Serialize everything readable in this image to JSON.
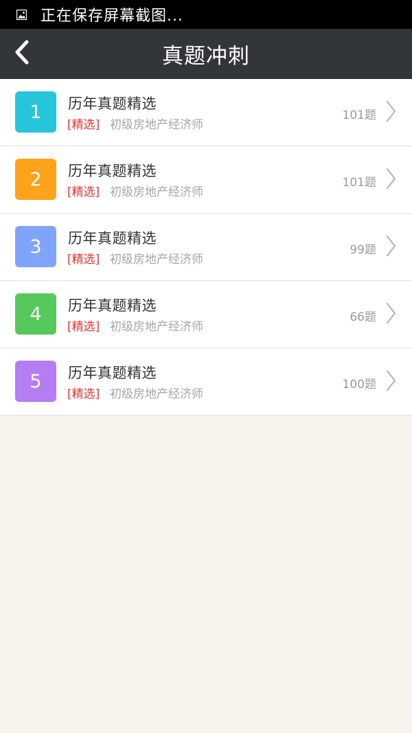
{
  "status_bar": {
    "icon": "image-icon",
    "text": "正在保存屏幕截图..."
  },
  "app_bar": {
    "back_icon": "chevron-left-icon",
    "title": "真题冲刺"
  },
  "items": [
    {
      "number": "1",
      "title": "历年真题精选",
      "tag": "[精选]",
      "subtitle": "初级房地产经济师",
      "count": "101题",
      "color": "#26c6da"
    },
    {
      "number": "2",
      "title": "历年真题精选",
      "tag": "[精选]",
      "subtitle": "初级房地产经济师",
      "count": "101题",
      "color": "#ffa31a"
    },
    {
      "number": "3",
      "title": "历年真题精选",
      "tag": "[精选]",
      "subtitle": "初级房地产经济师",
      "count": "99题",
      "color": "#7fa4fb"
    },
    {
      "number": "4",
      "title": "历年真题精选",
      "tag": "[精选]",
      "subtitle": "初级房地产经济师",
      "count": "66题",
      "color": "#55c95b"
    },
    {
      "number": "5",
      "title": "历年真题精选",
      "tag": "[精选]",
      "subtitle": "初级房地产经济师",
      "count": "100题",
      "color": "#b57cf4"
    }
  ],
  "colors": {
    "status_bar": "#000000",
    "app_bar": "#333638",
    "background": "#f6f3ec",
    "tag": "#e8322f"
  }
}
